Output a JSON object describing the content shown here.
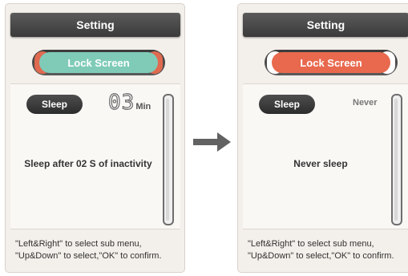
{
  "screens": [
    {
      "title": "Setting",
      "tab_label": "Lock Screen",
      "tab_color": "#7fcbb8",
      "accent_color": "#e06a50",
      "sleep_label": "Sleep",
      "value_digits": "03",
      "value_unit": "Min",
      "message": "Sleep after 02 S of inactivity",
      "hint_line1": "\"Left&Right\" to select sub menu,",
      "hint_line2": "\"Up&Down\" to select,\"OK\" to confirm."
    },
    {
      "title": "Setting",
      "tab_label": "Lock Screen",
      "tab_color": "#e8694e",
      "accent_color": "#ffffff",
      "sleep_label": "Sleep",
      "value_text": "Never",
      "message": "Never sleep",
      "hint_line1": "\"Left&Right\" to select sub menu,",
      "hint_line2": "\"Up&Down\" to select,\"OK\" to confirm."
    }
  ],
  "arrow_icon": "right-arrow-icon",
  "arrow_color": "#626262"
}
